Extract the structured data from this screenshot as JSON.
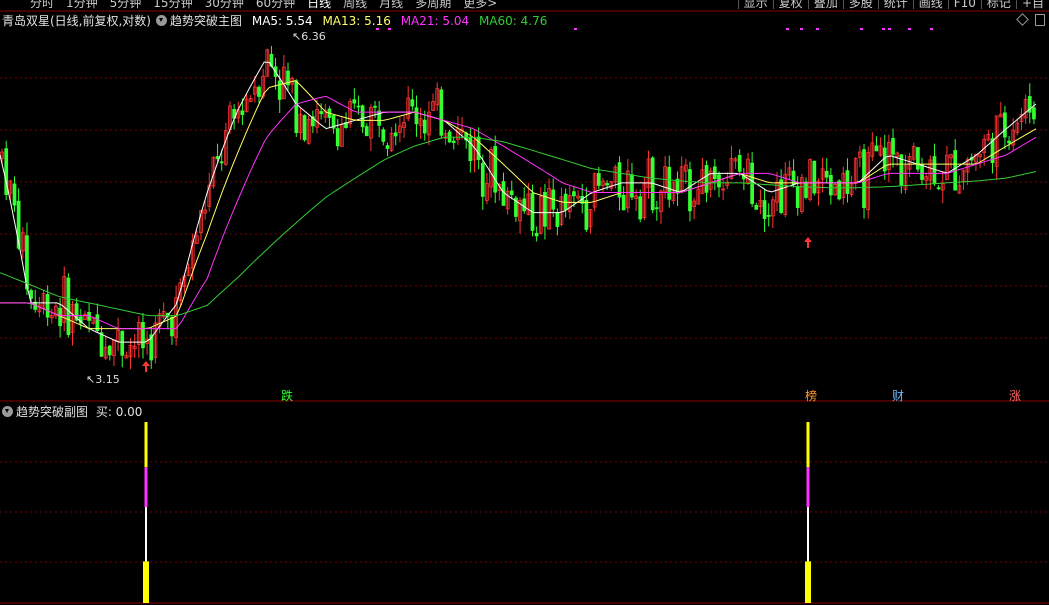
{
  "toolbar": {
    "periods": [
      "分时",
      "1分钟",
      "5分钟",
      "15分钟",
      "30分钟",
      "60分钟",
      "日线",
      "周线",
      "月线",
      "多周期",
      "更多>"
    ],
    "active_period": "日线",
    "right_buttons": [
      "显示",
      "复权",
      "叠加",
      "多股",
      "统计",
      "画线",
      "F10",
      "标记",
      "+自"
    ]
  },
  "header": {
    "stock": "青岛双星(日线,前复权,对数)",
    "indicator": "趋势突破主图",
    "ma5_label": "MA5: 5.54",
    "ma13_label": "MA13: 5.16",
    "ma21_label": "MA21: 5.04",
    "ma60_label": "MA60: 4.76"
  },
  "colors": {
    "ma5": "#ffffff",
    "ma13": "#ffff66",
    "ma21": "#ff33ff",
    "ma60": "#33cc33",
    "up_candle": "#ff3333",
    "down_candle": "#33ff33",
    "signal_arrow": "#ff3333",
    "grid": "#7a0000"
  },
  "annotations": {
    "high_label": "6.36",
    "low_label": "3.15"
  },
  "event_tags": [
    {
      "text": "跌",
      "color": "#33ff33"
    },
    {
      "text": "榜",
      "color": "#ff9933"
    },
    {
      "text": "财",
      "color": "#66bbff"
    },
    {
      "text": "涨",
      "color": "#ff6666"
    }
  ],
  "sub_header": {
    "name": "趋势突破副图",
    "buy_label": "买: 0.00"
  },
  "chart_data": {
    "type": "line",
    "scale": "log",
    "ylim": [
      3.0,
      6.6
    ],
    "high": 6.36,
    "low": 3.15,
    "series": [
      {
        "name": "MA5",
        "values": [
          5.0,
          3.6,
          3.6,
          3.4,
          3.3,
          3.3,
          3.6,
          4.6,
          5.5,
          6.2,
          5.6,
          5.3,
          5.4,
          5.5,
          5.5,
          5.4,
          5.1,
          4.6,
          4.4,
          4.4,
          4.6,
          4.7,
          4.7,
          4.6,
          4.8,
          4.8,
          4.6,
          4.7,
          4.7,
          4.7,
          5.0,
          4.9,
          4.8,
          5.0,
          5.3,
          5.6
        ]
      },
      {
        "name": "MA13",
        "values": [
          3.6,
          3.6,
          3.5,
          3.4,
          3.4,
          3.4,
          3.5,
          4.2,
          5.0,
          5.8,
          5.9,
          5.5,
          5.4,
          5.4,
          5.5,
          5.4,
          5.2,
          4.9,
          4.6,
          4.5,
          4.5,
          4.6,
          4.6,
          4.6,
          4.7,
          4.8,
          4.7,
          4.7,
          4.7,
          4.7,
          4.9,
          4.9,
          4.9,
          4.9,
          5.1,
          5.3
        ]
      },
      {
        "name": "MA21",
        "values": [
          3.6,
          3.6,
          3.5,
          3.5,
          3.4,
          3.4,
          3.4,
          3.8,
          4.5,
          5.2,
          5.6,
          5.7,
          5.5,
          5.5,
          5.5,
          5.4,
          5.3,
          5.1,
          4.9,
          4.7,
          4.6,
          4.6,
          4.6,
          4.6,
          4.7,
          4.8,
          4.8,
          4.7,
          4.7,
          4.7,
          4.8,
          4.8,
          4.8,
          4.9,
          5.0,
          5.2
        ]
      },
      {
        "name": "MA60",
        "values": [
          3.85,
          3.75,
          3.65,
          3.6,
          3.55,
          3.5,
          3.5,
          3.58,
          3.8,
          4.05,
          4.3,
          4.55,
          4.75,
          4.95,
          5.1,
          5.2,
          5.2,
          5.15,
          5.05,
          4.95,
          4.85,
          4.8,
          4.75,
          4.72,
          4.7,
          4.7,
          4.68,
          4.66,
          4.65,
          4.65,
          4.66,
          4.68,
          4.7,
          4.72,
          4.75,
          4.82
        ]
      }
    ],
    "sub_chart": {
      "type": "bar",
      "name": "趋势突破副图",
      "signals": [
        {
          "value": 1.0
        },
        {
          "value": 1.0
        }
      ]
    }
  }
}
